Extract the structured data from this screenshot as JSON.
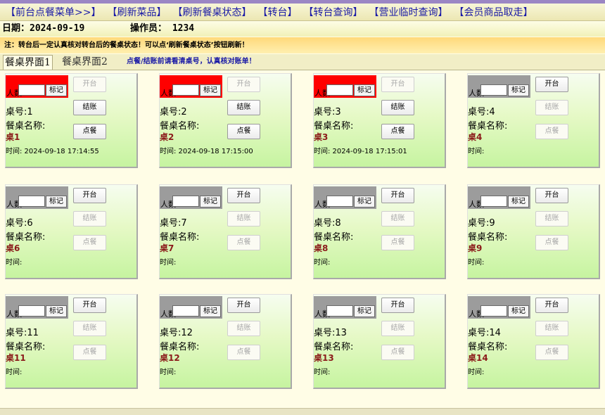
{
  "menu": {
    "items": [
      "【前台点餐菜单>>】",
      "【刷新菜品】",
      "【刷新餐桌状态】",
      "【转台】",
      "【转台查询】",
      "【营业临时查询】",
      "【会员商品取走】"
    ]
  },
  "info": {
    "date": "日期：2024-09-19",
    "operator": "操作员： 1234"
  },
  "notice": "注：转台后一定认真核对转台后的餐桌状态！可以点‘刷新餐桌状态’按钮刷新！",
  "tabs": {
    "tab1": "餐桌界面1",
    "tab2": "餐桌界面2",
    "note": "点餐/结账前请看清桌号，认真核对账单！"
  },
  "card_labels": {
    "people": "人数",
    "mark": "标记",
    "open": "开台",
    "checkout": "结账",
    "order": "点餐",
    "name_label": "餐桌名称:"
  },
  "tables": [
    {
      "num": "桌号:1",
      "name": "桌1",
      "time": "时间: 2024-09-18 17:14:55",
      "state": "busy"
    },
    {
      "num": "桌号:2",
      "name": "桌2",
      "time": "时间: 2024-09-18 17:15:00",
      "state": "busy"
    },
    {
      "num": "桌号:3",
      "name": "桌3",
      "time": "时间: 2024-09-18 17:15:01",
      "state": "busy"
    },
    {
      "num": "桌号:4",
      "name": "桌4",
      "time": "时间:",
      "state": "free"
    },
    {
      "num": "桌号:6",
      "name": "桌6",
      "time": "时间:",
      "state": "free"
    },
    {
      "num": "桌号:7",
      "name": "桌7",
      "time": "时间:",
      "state": "free"
    },
    {
      "num": "桌号:8",
      "name": "桌8",
      "time": "时间:",
      "state": "free"
    },
    {
      "num": "桌号:9",
      "name": "桌9",
      "time": "时间:",
      "state": "free"
    },
    {
      "num": "桌号:11",
      "name": "桌11",
      "time": "时间:",
      "state": "free"
    },
    {
      "num": "桌号:12",
      "name": "桌12",
      "time": "时间:",
      "state": "free"
    },
    {
      "num": "桌号:13",
      "name": "桌13",
      "time": "时间:",
      "state": "free"
    },
    {
      "num": "桌号:14",
      "name": "桌14",
      "time": "时间:",
      "state": "free"
    }
  ],
  "colors": {
    "busy_header": "#ff0000",
    "free_header": "#9c9c9c",
    "table_name": "#8b1a1a",
    "menu_text": "#1a1aa6"
  }
}
